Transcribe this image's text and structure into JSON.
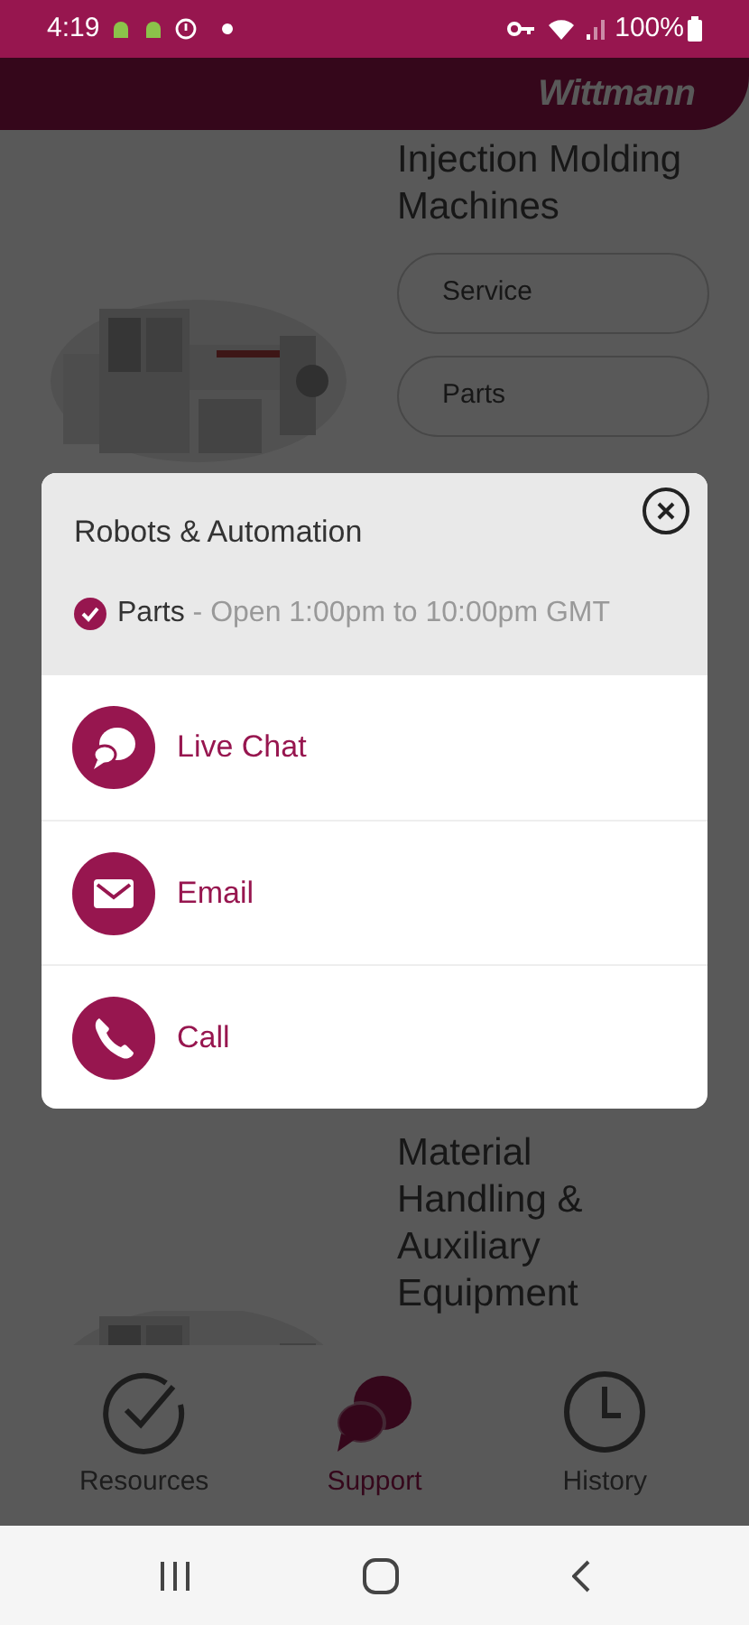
{
  "status_bar": {
    "time": "4:19",
    "battery": "100%"
  },
  "header": {
    "logo": "Wittmann"
  },
  "sections": [
    {
      "title": "Injection Molding Machines",
      "buttons": [
        "Service",
        "Parts"
      ],
      "picture": {
        "kind": "picture"
      }
    },
    {
      "title": "Material Handling & Auxiliary Equipment",
      "picture": {
        "kind": "picture"
      }
    }
  ],
  "dialog": {
    "title": "Robots & Automation",
    "status": {
      "checked": true,
      "department": "Parts",
      "hours": "- Open 1:00pm to 10:00pm GMT"
    },
    "options": [
      {
        "kind": "chat",
        "label": "Live Chat"
      },
      {
        "kind": "email",
        "label": "Email"
      },
      {
        "kind": "phone",
        "label": "Call"
      }
    ]
  },
  "bottom_nav": [
    {
      "kind": "check",
      "label": "Resources",
      "selected": false
    },
    {
      "kind": "chat",
      "label": "Support",
      "selected": true
    },
    {
      "kind": "clock",
      "label": "History",
      "selected": false
    }
  ]
}
